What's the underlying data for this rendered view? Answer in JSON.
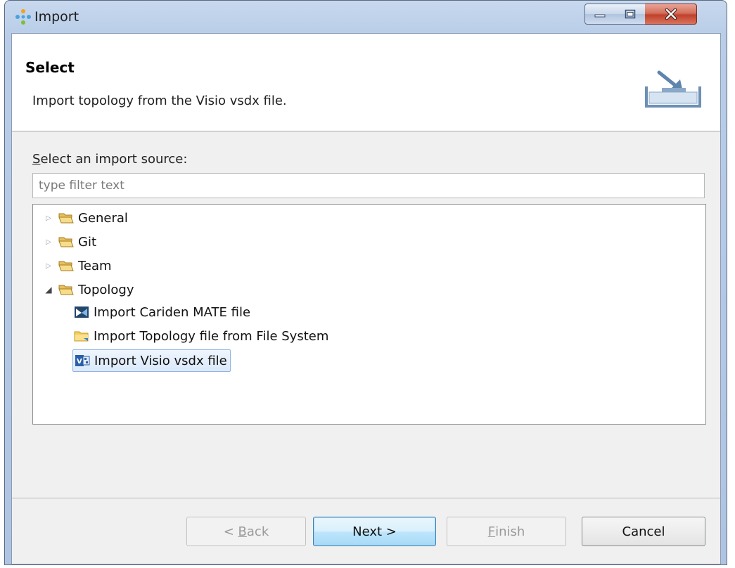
{
  "window": {
    "title": "Import"
  },
  "header": {
    "title": "Select",
    "description": "Import topology from the Visio vsdx file."
  },
  "source": {
    "label_mnemonic": "S",
    "label_rest": "elect an import source:",
    "filter_placeholder": "type filter text"
  },
  "tree": {
    "items": [
      {
        "label": "General",
        "icon": "folder-icon",
        "expanded": false
      },
      {
        "label": "Git",
        "icon": "folder-icon",
        "expanded": false
      },
      {
        "label": "Team",
        "icon": "folder-icon",
        "expanded": false
      },
      {
        "label": "Topology",
        "icon": "folder-icon",
        "expanded": true
      },
      {
        "label": "Import Cariden MATE file",
        "icon": "mate-file-icon"
      },
      {
        "label": "Import Topology file from File System",
        "icon": "yellow-folder-icon"
      },
      {
        "label": "Import Visio vsdx file",
        "icon": "visio-icon",
        "selected": true
      }
    ]
  },
  "buttons": {
    "back_prefix": "< ",
    "back_mnemonic": "B",
    "back_rest": "ack",
    "next": "Next >",
    "finish_mnemonic": "F",
    "finish_rest": "inish",
    "cancel": "Cancel"
  },
  "colors": {
    "window_frame": "#b9cde8",
    "selection": "#dbe9fa",
    "default_button": "#bee6fd",
    "close_button": "#c0412b"
  }
}
